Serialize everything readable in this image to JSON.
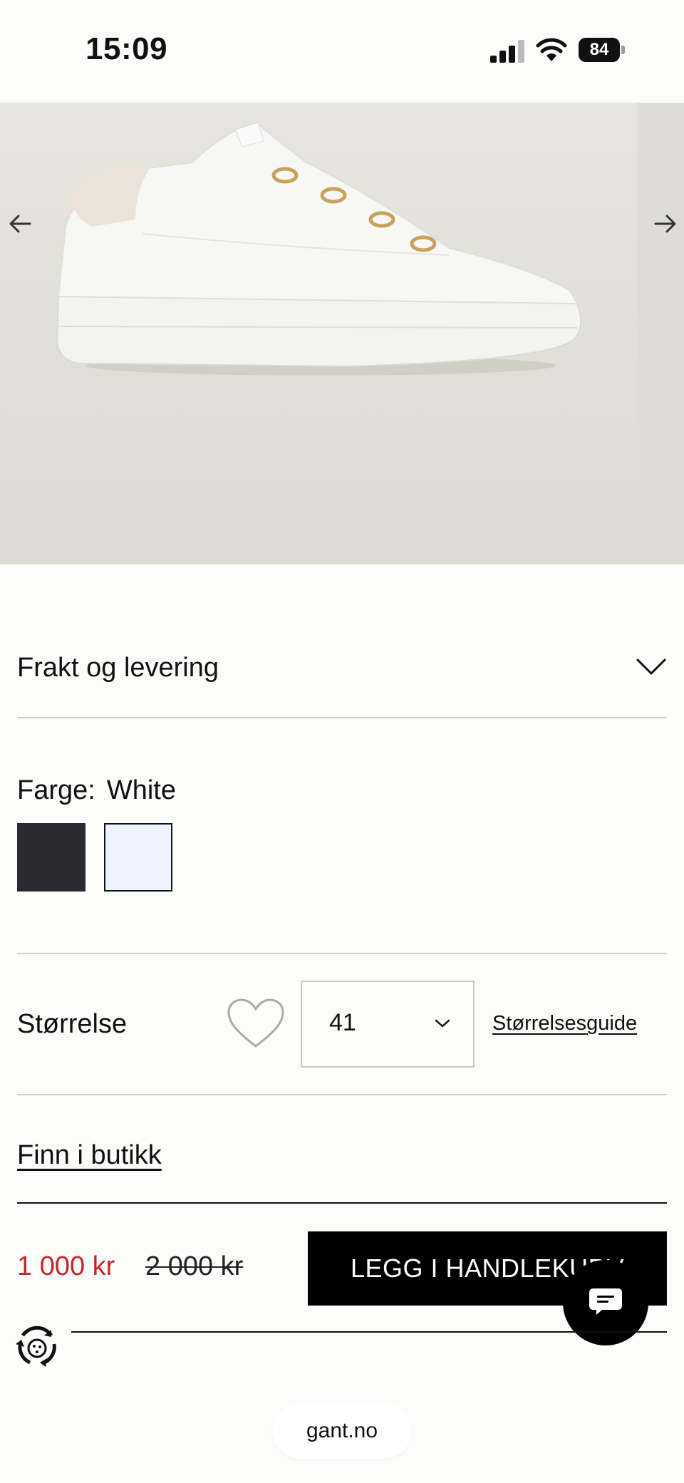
{
  "status_bar": {
    "time": "15:09",
    "battery": "84"
  },
  "gallery": {
    "prev_icon": "arrow-left-icon",
    "next_icon": "arrow-right-icon",
    "image_alt": "White GANT leather sneaker with beige heel tab"
  },
  "shipping": {
    "label": "Frakt og levering",
    "icon": "chevron-down-icon"
  },
  "color": {
    "label": "Farge:",
    "selected": "White",
    "swatches": [
      {
        "name": "black",
        "hex": "#2a2a30"
      },
      {
        "name": "white",
        "hex": "#eef4ff"
      }
    ]
  },
  "size": {
    "label": "Størrelse",
    "selected": "41",
    "guide_label": "Størrelsesguide",
    "wishlist_icon": "heart-icon"
  },
  "store": {
    "find_label": "Finn i butikk"
  },
  "price": {
    "sale": "1 000 kr",
    "original": "2 000 kr",
    "sale_color": "#c6262b"
  },
  "cta": {
    "label": "LEGG I HANDLEKURV"
  },
  "chat": {
    "icon": "chat-icon"
  },
  "browser": {
    "url": "gant.no"
  }
}
